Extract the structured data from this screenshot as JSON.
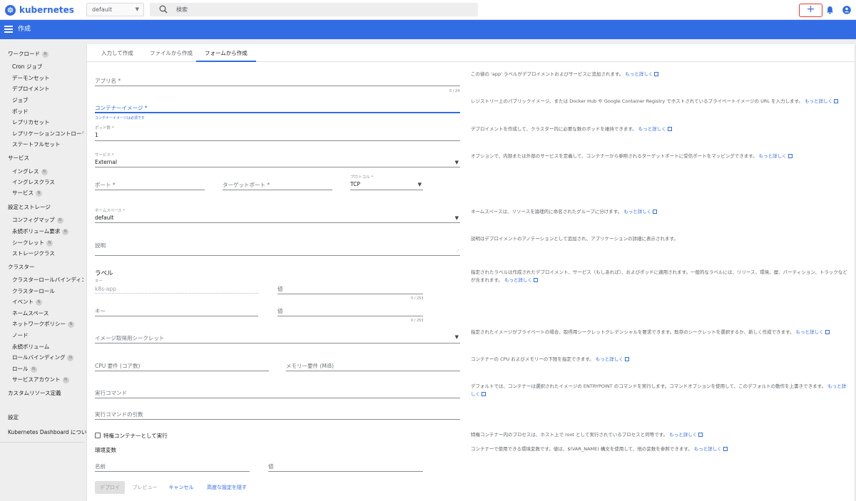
{
  "app": {
    "brand": "kubernetes",
    "namespace": "default",
    "search_placeholder": "検索",
    "create_symbol": "+"
  },
  "toolbar": {
    "title": "作成"
  },
  "sidebar": {
    "workloads": "ワークロード",
    "workloads_badge": "N",
    "w_items": [
      "Cron ジョブ",
      "デーモンセット",
      "デプロイメント",
      "ジョブ",
      "ポッド",
      "レプリカセット",
      "レプリケーションコントローラー",
      "ステートフルセット"
    ],
    "services": "サービス",
    "s_items": [
      "イングレス",
      "イングレスクラス",
      "サービス"
    ],
    "storage": "設定とストレージ",
    "st_items": [
      "コンフィグマップ",
      "永続ボリューム要求",
      "シークレット",
      "ストレージクラス"
    ],
    "cluster": "クラスター",
    "c_items": [
      "クラスターロールバインディング",
      "クラスターロール",
      "イベント",
      "ネームスペース",
      "ネットワークポリシー",
      "ノード",
      "永続ボリューム",
      "ロールバインディング",
      "ロール",
      "サービスアカウント"
    ],
    "crd": "カスタムリソース定義",
    "settings": "設定",
    "about": "Kubernetes Dashboard について",
    "badge": "N"
  },
  "tabs": [
    "入力して作成",
    "ファイルから作成",
    "フォームから作成"
  ],
  "form": {
    "app_name": "アプリ名 *",
    "app_name_count": "0 / 24",
    "image": "コンテナーイメージ *",
    "image_error": "コンテナーイメージは必須です",
    "pods_label": "ポッド数 *",
    "pods_value": "1",
    "service_label": "サービス *",
    "service_value": "External",
    "port": "ポート *",
    "target_port": "ターゲットポート *",
    "protocol_label": "プロトコル *",
    "protocol_value": "TCP",
    "ns_label": "ネームスペース *",
    "ns_value": "default",
    "description": "説明",
    "labels_title": "ラベル",
    "key_small": "キー",
    "key_value": "k8s-app",
    "value_label": "値",
    "count_253": "0 / 253",
    "key2": "キー",
    "value2": "値",
    "pull_secret": "イメージ取得用シークレット",
    "cpu": "CPU 要件 (コア数)",
    "memory": "メモリー要件 (MiB)",
    "run_cmd": "実行コマンド",
    "run_args": "実行コマンドの引数",
    "privileged": "特権コンテナーとして実行",
    "env_title": "環境変数",
    "env_name": "名前",
    "env_value": "値"
  },
  "help": {
    "app": "この値の 'app' ラベルがデプロイメントおよびサービスに追加されます。",
    "image": "レジストリー上のパブリックイメージ、または Docker Hub や Google Container Registry でホストされているプライベートイメージの URL を入力します。",
    "pods": "デプロイメントを作成して、クラスター内に必要な数のポッドを維持できます。",
    "service": "オプションで、内部または外部のサービスを定義して、コンテナーから参照されるターゲットポートに受信ポートをマッピングできます。",
    "ns": "ネームスペースは、リソースを論理的に命名されたグループに分けます。",
    "desc": "説明はデプロイメントのアノテーションとして追加され、アプリケーションの詳細に表示されます。",
    "labels": "指定されたラベルは作成されたデプロイメント、サービス（もしあれば）、およびポッドに適用されます。一般的なラベルには、リリース、環境、層、パーティション、トラックなどが含まれます。",
    "secret": "指定されたイメージがプライベートの場合、取得用シークレットクレデンシャルを要求できます。既存のシークレットを選択するか、新しく作成できます。",
    "cpu": "コンテナーの CPU およびメモリーの下限を指定できます。",
    "cmd": "デフォルトでは、コンテナーは選択されたイメージの ENTRYPOINT のコマンドを実行します。コマンドオプションを使用して、このデフォルトの動作を上書きできます。",
    "priv": "特権コンテナー内のプロセスは、ホスト上で root として実行されているプロセスと同等です。",
    "env": "コンテナーで使用できる環境変数です。値は、$(VAR_NAME) 構文を使用して、他の変数を参照できます。",
    "more": "もっと詳しく"
  },
  "buttons": {
    "deploy": "デプロイ",
    "preview": "プレビュー",
    "cancel": "キャンセル",
    "advanced": "高度な設定を隠す"
  },
  "colors": {
    "primary": "#326ce5",
    "highlight": "#e53935"
  }
}
